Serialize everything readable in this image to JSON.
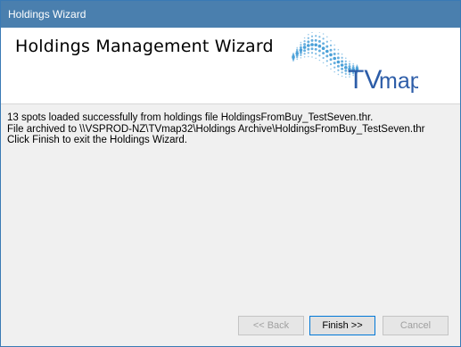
{
  "window": {
    "title": "Holdings Wizard"
  },
  "header": {
    "title": "Holdings Management Wizard",
    "logo": {
      "text_tv": "TV",
      "text_map": "map",
      "icon": "tvmap-logo"
    }
  },
  "message": {
    "lines": [
      "13 spots loaded successfully from holdings file HoldingsFromBuy_TestSeven.thr.",
      "File archived to \\\\VSPROD-NZ\\TVmap32\\Holdings Archive\\HoldingsFromBuy_TestSeven.thr",
      "Click Finish to exit the Holdings Wizard."
    ]
  },
  "buttons": {
    "back_label": "<< Back",
    "finish_label": "Finish >>",
    "cancel_label": "Cancel"
  },
  "colors": {
    "titlebar": "#4a7fae",
    "logo_blue": "#2d5da8",
    "logo_dots": "#4aa0d8"
  }
}
